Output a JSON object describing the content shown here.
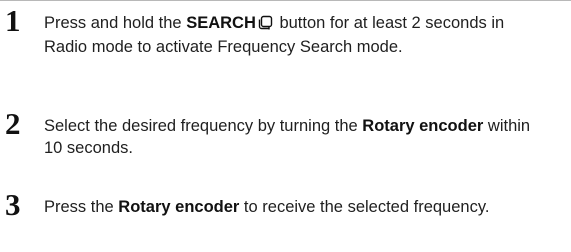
{
  "steps": [
    {
      "number": "1",
      "t1": "Press and hold the ",
      "b1": "SEARCH",
      "t2": " button for at least 2 seconds in Radio mode to activate Frequency Search mode.",
      "icon": "search-button-icon"
    },
    {
      "number": "2",
      "t1": "Select the desired frequency by turning the ",
      "b1": "Rotary encoder",
      "t2": " within 10 seconds."
    },
    {
      "number": "3",
      "t1": "Press the ",
      "b1": "Rotary encoder",
      "t2": " to receive the selected frequency."
    }
  ]
}
